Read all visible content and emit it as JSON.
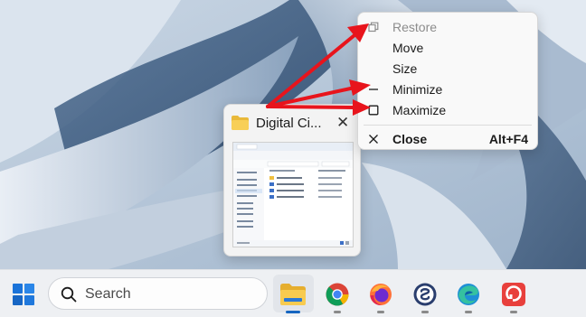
{
  "context_menu": {
    "items": [
      {
        "label": "Restore",
        "icon": "restore-icon",
        "disabled": true
      },
      {
        "label": "Move",
        "icon": "",
        "disabled": false
      },
      {
        "label": "Size",
        "icon": "",
        "disabled": false
      },
      {
        "label": "Minimize",
        "icon": "minimize-icon",
        "disabled": false
      },
      {
        "label": "Maximize",
        "icon": "maximize-icon",
        "disabled": false
      }
    ],
    "close": {
      "label": "Close",
      "shortcut": "Alt+F4",
      "icon": "close-icon"
    }
  },
  "thumbnail": {
    "title": "Digital Ci...",
    "close_glyph": "✕",
    "mini_window": {
      "title": "Digital Citizen",
      "sidebar_items": [
        "Desktop",
        "Downloads",
        "Documents",
        "Pictures",
        "PC",
        "Recycle Bin",
        "Linux",
        "Network"
      ],
      "files": [
        "Digital Citizen",
        "Digital Citizen.doc",
        "Digital Citizen.doc",
        "Digital Citizen.doc"
      ]
    }
  },
  "taskbar": {
    "search_placeholder": "Search",
    "apps": [
      "start",
      "search",
      "file-explorer",
      "chrome",
      "firefox",
      "simplenote",
      "edge",
      "pocketcasts"
    ]
  },
  "colors": {
    "annotation_arrow": "#e8141c",
    "taskbar_bg": "#eef0f3",
    "active_indicator": "#1565c0"
  }
}
